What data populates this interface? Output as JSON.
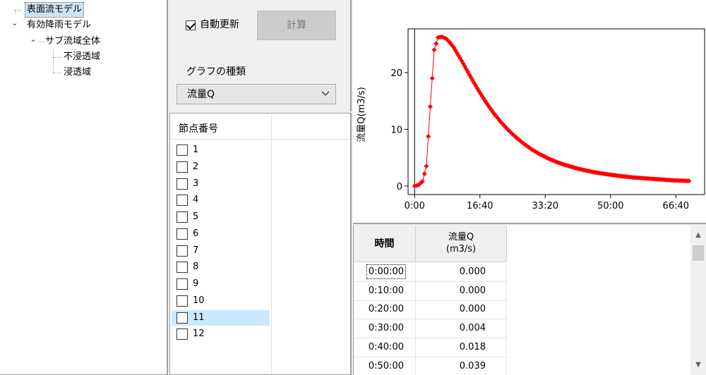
{
  "tree": {
    "items": [
      {
        "label": "表面流モデル",
        "level": 0,
        "expander": "none",
        "selected": true
      },
      {
        "label": "有効降雨モデル",
        "level": 0,
        "expander": "expanded",
        "selected": false
      },
      {
        "label": "サブ流域全体",
        "level": 1,
        "expander": "expanded",
        "selected": false
      },
      {
        "label": "不浸透域",
        "level": 2,
        "expander": "none",
        "selected": false
      },
      {
        "label": "浸透域",
        "level": 2,
        "expander": "none",
        "selected": false
      }
    ]
  },
  "settings": {
    "auto_update_label": "自動更新",
    "auto_update_checked": true,
    "calc_button_label": "計算",
    "graph_type_label": "グラフの種類",
    "graph_type_value": "流量Q"
  },
  "nodes": {
    "header": "節点番号",
    "items": [
      {
        "label": "1",
        "checked": false
      },
      {
        "label": "2",
        "checked": false
      },
      {
        "label": "3",
        "checked": false
      },
      {
        "label": "4",
        "checked": false
      },
      {
        "label": "5",
        "checked": false
      },
      {
        "label": "6",
        "checked": false
      },
      {
        "label": "7",
        "checked": false
      },
      {
        "label": "8",
        "checked": false
      },
      {
        "label": "9",
        "checked": false
      },
      {
        "label": "10",
        "checked": false
      },
      {
        "label": "11",
        "checked": false,
        "highlighted": true
      },
      {
        "label": "12",
        "checked": false
      }
    ]
  },
  "chart_data": {
    "type": "line",
    "ylabel": "流量Q(m3/s)",
    "xlabel": "",
    "x_tick_labels": [
      "0:00",
      "16:40",
      "33:20",
      "50:00",
      "66:40"
    ],
    "x_ticks_minutes": [
      0,
      1000,
      2000,
      3000,
      4000
    ],
    "y_ticks": [
      0,
      10,
      20
    ],
    "xlim": [
      -100,
      4440
    ],
    "ylim": [
      -1.5,
      27.7
    ],
    "marker_color": "#ff0000",
    "series": [
      {
        "x": [
          0,
          60,
          120,
          180,
          240,
          300,
          360,
          420,
          480,
          540,
          600,
          720,
          840,
          960,
          1080,
          1200,
          1320,
          1440,
          1560,
          1680,
          1800,
          1920,
          2040,
          2160,
          2280,
          2400,
          2520,
          2640,
          2760,
          2880,
          3000,
          3120,
          3240,
          3360,
          3480,
          3600,
          3720,
          3840,
          3960,
          4080,
          4200
        ],
        "y": [
          0,
          0.2,
          0.8,
          3.5,
          14,
          24,
          26.2,
          26.3,
          26.0,
          25.3,
          24.4,
          22.1,
          19.6,
          17.2,
          15.0,
          13.0,
          11.3,
          9.8,
          8.5,
          7.4,
          6.4,
          5.6,
          4.9,
          4.3,
          3.8,
          3.4,
          3.0,
          2.7,
          2.4,
          2.2,
          2.0,
          1.8,
          1.65,
          1.5,
          1.4,
          1.3,
          1.2,
          1.1,
          1.0,
          0.95,
          0.9
        ]
      }
    ]
  },
  "table": {
    "col_time": "時間",
    "col_flow_line1": "流量Q",
    "col_flow_line2": "(m3/s)",
    "rows": [
      {
        "time": "0:00:00",
        "flow": "0.000"
      },
      {
        "time": "0:10:00",
        "flow": "0.000"
      },
      {
        "time": "0:20:00",
        "flow": "0.000"
      },
      {
        "time": "0:30:00",
        "flow": "0.004"
      },
      {
        "time": "0:40:00",
        "flow": "0.018"
      },
      {
        "time": "0:50:00",
        "flow": "0.039"
      }
    ]
  }
}
